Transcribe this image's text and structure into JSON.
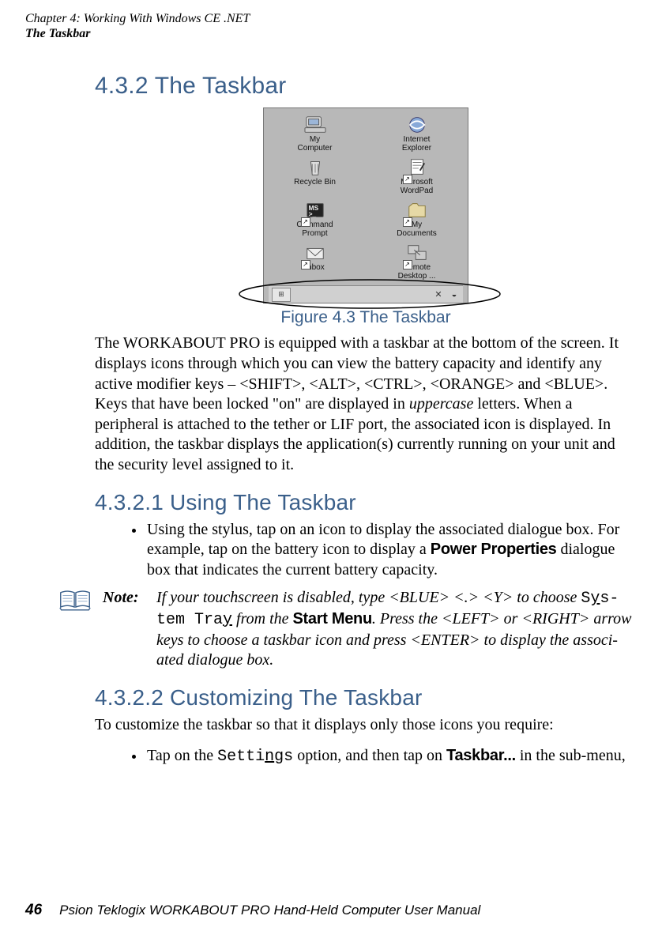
{
  "running_head": {
    "line1": "Chapter  4:  Working With Windows CE .NET",
    "line2": "The Taskbar"
  },
  "section": {
    "num_title": "4.3.2  The Taskbar"
  },
  "figure": {
    "caption": "Figure 4.3 The Taskbar",
    "desktop_icons": [
      {
        "label_l1": "My",
        "label_l2": "Computer",
        "kind": "computer",
        "shortcut": false
      },
      {
        "label_l1": "Internet",
        "label_l2": "Explorer",
        "kind": "ie",
        "shortcut": false
      },
      {
        "label_l1": "Recycle Bin",
        "label_l2": "",
        "kind": "recycle",
        "shortcut": false
      },
      {
        "label_l1": "Microsoft",
        "label_l2": "WordPad",
        "kind": "wordpad",
        "shortcut": true
      },
      {
        "label_l1": "Command",
        "label_l2": "Prompt",
        "kind": "cmd",
        "shortcut": true
      },
      {
        "label_l1": "My",
        "label_l2": "Documents",
        "kind": "docs",
        "shortcut": true
      },
      {
        "label_l1": "Inbox",
        "label_l2": "",
        "kind": "inbox",
        "shortcut": true
      },
      {
        "label_l1": "Remote",
        "label_l2": "Desktop ...",
        "kind": "rdp",
        "shortcut": true
      }
    ],
    "taskbar": {
      "start_symbol": "⊞",
      "tray": [
        "✕",
        "◒"
      ]
    }
  },
  "para1": "The WORKABOUT PRO is equipped with a taskbar at the bottom of the screen. It displays icons through which you can view the battery capacity and identify any active modifier keys – <SHIFT>, <ALT>, <CTRL>, <ORANGE> and <BLUE>. Keys that have been locked \"on\" are displayed in ",
  "para1_em": "uppercase",
  "para1_tail": " letters. When a peripheral is attached to the tether or LIF port, the associated icon is displayed. In addition, the taskbar displays the application(s) currently running on your unit and the security level assigned to it.",
  "subsection1": {
    "title": "4.3.2.1    Using The Taskbar",
    "bullet_pre": "Using the stylus, tap on an icon to display the associated dialogue box. For example, tap on the battery icon to display a ",
    "bullet_bold": "Power Properties",
    "bullet_post": " dialogue box that indicates the current battery capacity."
  },
  "note": {
    "label": "Note:",
    "pre": "If your touchscreen is disabled, type <BLUE> <.> <Y> to choose ",
    "mono_pre": "S",
    "mono_u1": "y",
    "mono_mid1": "s-",
    "mono_break": "tem Tra",
    "mono_u2": "y",
    "mid1": " from the ",
    "sans": "Start Menu",
    "mid2": ". Press the <LEFT> or <RIGHT> arrow keys to choose a taskbar icon and press <ENTER> to display the associ-",
    "tail": "ated dialogue box."
  },
  "subsection2": {
    "title": "4.3.2.2    Customizing The Taskbar",
    "lead": "To customize the taskbar so that it displays only those icons you require:",
    "bullet_pre": "Tap on the ",
    "mono_pre": "Setti",
    "mono_u": "n",
    "mono_post": "gs",
    "bullet_mid": " option, and then tap on ",
    "sans": "Taskbar...",
    "bullet_post": " in the sub-menu,"
  },
  "footer": {
    "page": "46",
    "text": "Psion Teklogix WORKABOUT PRO Hand-Held Computer User Manual"
  }
}
